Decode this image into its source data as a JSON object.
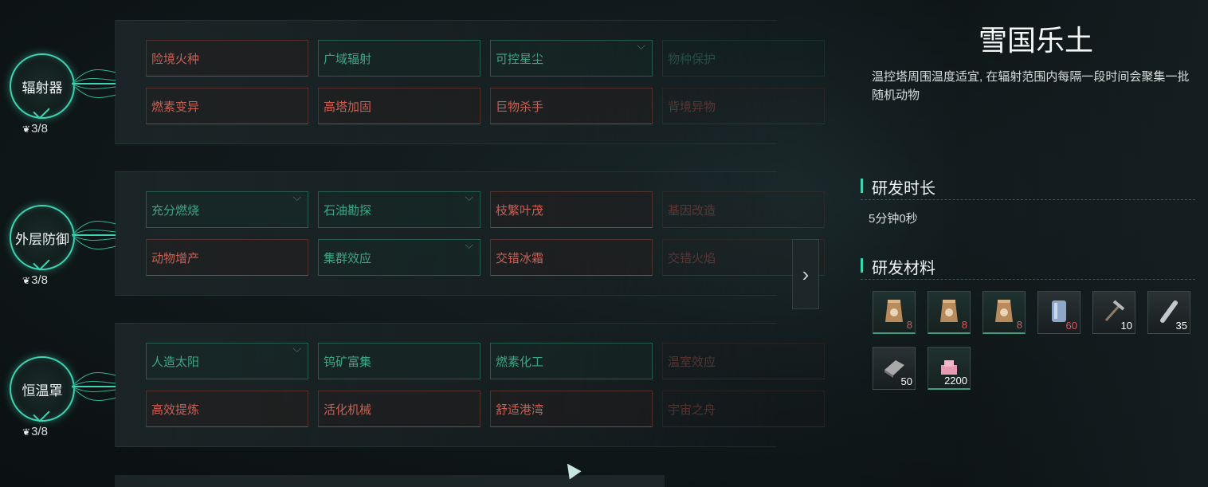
{
  "tech_rows": [
    {
      "node_label": "辐射器",
      "progress": "3/8",
      "cards_top": [
        {
          "label": "险境火种",
          "state": "red"
        },
        {
          "label": "广域辐射",
          "state": "green"
        },
        {
          "label": "可控星尘",
          "state": "green"
        },
        {
          "label": "物种保护",
          "state": "faded"
        }
      ],
      "cards_bottom": [
        {
          "label": "燃素变异",
          "state": "red"
        },
        {
          "label": "高塔加固",
          "state": "red"
        },
        {
          "label": "巨物杀手",
          "state": "red"
        },
        {
          "label": "背境异物",
          "state": "faded"
        }
      ]
    },
    {
      "node_label": "外层防御",
      "progress": "3/8",
      "cards_top": [
        {
          "label": "充分燃烧",
          "state": "green"
        },
        {
          "label": "石油勘探",
          "state": "green"
        },
        {
          "label": "枝繁叶茂",
          "state": "red"
        },
        {
          "label": "基因改造",
          "state": "faded"
        }
      ],
      "cards_bottom": [
        {
          "label": "动物增产",
          "state": "red"
        },
        {
          "label": "集群效应",
          "state": "green"
        },
        {
          "label": "交错冰霜",
          "state": "red"
        },
        {
          "label": "交错火焰",
          "state": "faded"
        }
      ]
    },
    {
      "node_label": "恒温罩",
      "progress": "3/8",
      "cards_top": [
        {
          "label": "人造太阳",
          "state": "green"
        },
        {
          "label": "钨矿富集",
          "state": "green"
        },
        {
          "label": "燃素化工",
          "state": "green"
        },
        {
          "label": "温室效应",
          "state": "faded"
        }
      ],
      "cards_bottom": [
        {
          "label": "高效提炼",
          "state": "red"
        },
        {
          "label": "活化机械",
          "state": "red"
        },
        {
          "label": "舒适港湾",
          "state": "red"
        },
        {
          "label": "宇宙之舟",
          "state": "faded"
        }
      ]
    }
  ],
  "detail": {
    "title": "雪国乐土",
    "description": "温控塔周围温度适宜, 在辐射范围内每隔一段时间会聚集一批随机动物",
    "duration_header": "研发时长",
    "duration_value": "5分钟0秒",
    "materials_header": "研发材料",
    "materials": [
      {
        "icon": "seed-bag-icon",
        "qty": "8",
        "short": true,
        "rim": "green"
      },
      {
        "icon": "seed-bag-icon",
        "qty": "8",
        "short": true,
        "rim": "green"
      },
      {
        "icon": "seed-bag-icon",
        "qty": "8",
        "short": true,
        "rim": "green"
      },
      {
        "icon": "metal-canister-icon",
        "qty": "60",
        "short": true,
        "rim": "none"
      },
      {
        "icon": "pickaxe-icon",
        "qty": "10",
        "short": false,
        "rim": "none"
      },
      {
        "icon": "steel-pipe-icon",
        "qty": "35",
        "short": false,
        "rim": "none"
      },
      {
        "icon": "iron-plate-icon",
        "qty": "50",
        "short": false,
        "rim": "none"
      },
      {
        "icon": "pink-crystal-icon",
        "qty": "2200",
        "short": false,
        "rim": "green"
      }
    ]
  },
  "toggle_icon": "chevron-right-icon",
  "colors": {
    "accent": "#3fd3b3",
    "locked": "#c86055",
    "unlocked": "#3ea587",
    "shortage": "#e0555a"
  }
}
